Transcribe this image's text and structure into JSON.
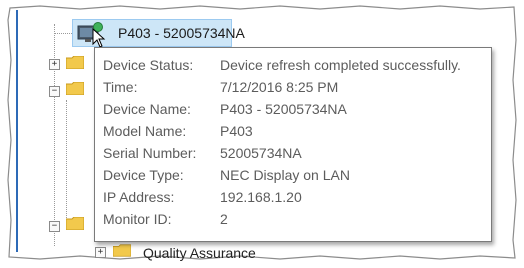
{
  "tree": {
    "selected_device": {
      "label": "P403 - 52005734NA",
      "icon": "display-device-icon"
    },
    "bottom_item": {
      "label": "Quality Assurance",
      "icon": "folder-icon"
    }
  },
  "tooltip": {
    "rows": [
      {
        "label": "Device Status:",
        "value": "Device refresh completed successfully."
      },
      {
        "label": "Time:",
        "value": "7/12/2016 8:25 PM"
      },
      {
        "label": "Device Name:",
        "value": "P403 - 52005734NA"
      },
      {
        "label": "Model Name:",
        "value": "P403"
      },
      {
        "label": "Serial Number:",
        "value": "52005734NA"
      },
      {
        "label": "Device Type:",
        "value": "NEC Display on LAN"
      },
      {
        "label": "IP Address:",
        "value": "192.168.1.20"
      },
      {
        "label": "Monitor ID:",
        "value": "2"
      }
    ]
  },
  "colors": {
    "selection": "#cde6f7",
    "accent_line": "#2d6ab7",
    "folder": "#f2c94c"
  }
}
